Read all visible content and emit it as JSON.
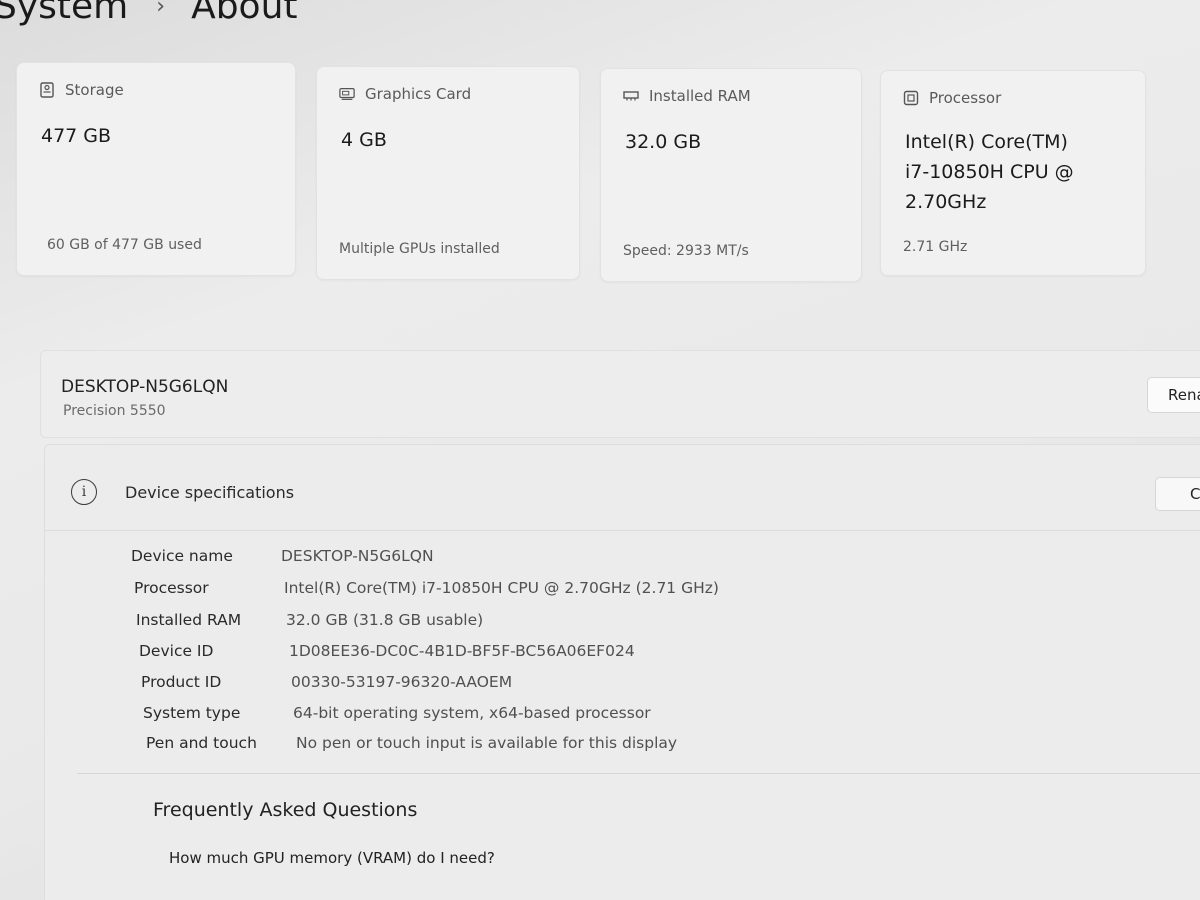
{
  "breadcrumb": {
    "root": "System",
    "separator": "›",
    "current": "About"
  },
  "cards": [
    {
      "icon": "storage-icon",
      "label": "Storage",
      "value": "477 GB",
      "sub": "60 GB of 477 GB used"
    },
    {
      "icon": "graphics-card-icon",
      "label": "Graphics Card",
      "value": "4 GB",
      "sub": "Multiple GPUs installed"
    },
    {
      "icon": "ram-icon",
      "label": "Installed RAM",
      "value": "32.0 GB",
      "sub": "Speed: 2933 MT/s"
    },
    {
      "icon": "processor-icon",
      "label": "Processor",
      "value_lines": [
        "Intel(R) Core(TM)",
        "i7-10850H CPU @",
        "2.70GHz"
      ],
      "sub": "2.71 GHz"
    }
  ],
  "device": {
    "name": "DESKTOP-N5G6LQN",
    "model": "Precision 5550",
    "rename_label": "Rena"
  },
  "specs": {
    "title": "Device specifications",
    "copy_label": "C",
    "rows": [
      {
        "label": "Device name",
        "value": "DESKTOP-N5G6LQN"
      },
      {
        "label": "Processor",
        "value": "Intel(R) Core(TM) i7-10850H CPU @ 2.70GHz (2.71 GHz)"
      },
      {
        "label": "Installed RAM",
        "value": "32.0 GB (31.8 GB usable)"
      },
      {
        "label": "Device ID",
        "value": "1D08EE36-DC0C-4B1D-BF5F-BC56A06EF024"
      },
      {
        "label": "Product ID",
        "value": "00330-53197-96320-AAOEM"
      },
      {
        "label": "System type",
        "value": "64-bit operating system, x64-based processor"
      },
      {
        "label": "Pen and touch",
        "value": "No pen or touch input is available for this display"
      }
    ]
  },
  "faq": {
    "title": "Frequently Asked Questions",
    "questions": [
      "How much GPU memory (VRAM) do I need?"
    ]
  }
}
